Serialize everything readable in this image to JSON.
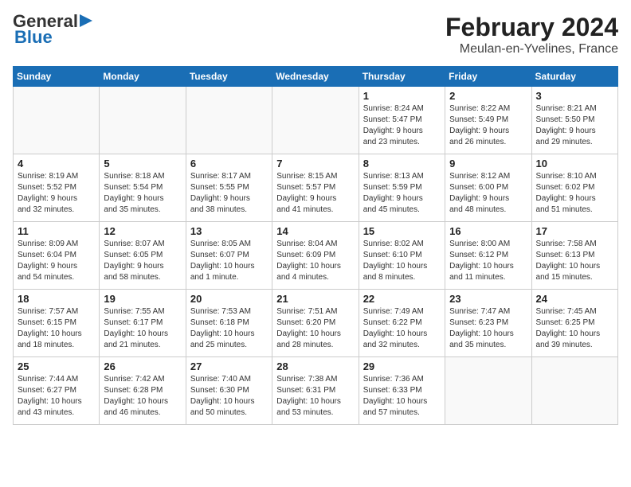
{
  "header": {
    "logo_line1": "General",
    "logo_line2": "Blue",
    "title": "February 2024",
    "subtitle": "Meulan-en-Yvelines, France"
  },
  "days_of_week": [
    "Sunday",
    "Monday",
    "Tuesday",
    "Wednesday",
    "Thursday",
    "Friday",
    "Saturday"
  ],
  "weeks": [
    [
      {
        "day": "",
        "info": ""
      },
      {
        "day": "",
        "info": ""
      },
      {
        "day": "",
        "info": ""
      },
      {
        "day": "",
        "info": ""
      },
      {
        "day": "1",
        "info": "Sunrise: 8:24 AM\nSunset: 5:47 PM\nDaylight: 9 hours\nand 23 minutes."
      },
      {
        "day": "2",
        "info": "Sunrise: 8:22 AM\nSunset: 5:49 PM\nDaylight: 9 hours\nand 26 minutes."
      },
      {
        "day": "3",
        "info": "Sunrise: 8:21 AM\nSunset: 5:50 PM\nDaylight: 9 hours\nand 29 minutes."
      }
    ],
    [
      {
        "day": "4",
        "info": "Sunrise: 8:19 AM\nSunset: 5:52 PM\nDaylight: 9 hours\nand 32 minutes."
      },
      {
        "day": "5",
        "info": "Sunrise: 8:18 AM\nSunset: 5:54 PM\nDaylight: 9 hours\nand 35 minutes."
      },
      {
        "day": "6",
        "info": "Sunrise: 8:17 AM\nSunset: 5:55 PM\nDaylight: 9 hours\nand 38 minutes."
      },
      {
        "day": "7",
        "info": "Sunrise: 8:15 AM\nSunset: 5:57 PM\nDaylight: 9 hours\nand 41 minutes."
      },
      {
        "day": "8",
        "info": "Sunrise: 8:13 AM\nSunset: 5:59 PM\nDaylight: 9 hours\nand 45 minutes."
      },
      {
        "day": "9",
        "info": "Sunrise: 8:12 AM\nSunset: 6:00 PM\nDaylight: 9 hours\nand 48 minutes."
      },
      {
        "day": "10",
        "info": "Sunrise: 8:10 AM\nSunset: 6:02 PM\nDaylight: 9 hours\nand 51 minutes."
      }
    ],
    [
      {
        "day": "11",
        "info": "Sunrise: 8:09 AM\nSunset: 6:04 PM\nDaylight: 9 hours\nand 54 minutes."
      },
      {
        "day": "12",
        "info": "Sunrise: 8:07 AM\nSunset: 6:05 PM\nDaylight: 9 hours\nand 58 minutes."
      },
      {
        "day": "13",
        "info": "Sunrise: 8:05 AM\nSunset: 6:07 PM\nDaylight: 10 hours\nand 1 minute."
      },
      {
        "day": "14",
        "info": "Sunrise: 8:04 AM\nSunset: 6:09 PM\nDaylight: 10 hours\nand 4 minutes."
      },
      {
        "day": "15",
        "info": "Sunrise: 8:02 AM\nSunset: 6:10 PM\nDaylight: 10 hours\nand 8 minutes."
      },
      {
        "day": "16",
        "info": "Sunrise: 8:00 AM\nSunset: 6:12 PM\nDaylight: 10 hours\nand 11 minutes."
      },
      {
        "day": "17",
        "info": "Sunrise: 7:58 AM\nSunset: 6:13 PM\nDaylight: 10 hours\nand 15 minutes."
      }
    ],
    [
      {
        "day": "18",
        "info": "Sunrise: 7:57 AM\nSunset: 6:15 PM\nDaylight: 10 hours\nand 18 minutes."
      },
      {
        "day": "19",
        "info": "Sunrise: 7:55 AM\nSunset: 6:17 PM\nDaylight: 10 hours\nand 21 minutes."
      },
      {
        "day": "20",
        "info": "Sunrise: 7:53 AM\nSunset: 6:18 PM\nDaylight: 10 hours\nand 25 minutes."
      },
      {
        "day": "21",
        "info": "Sunrise: 7:51 AM\nSunset: 6:20 PM\nDaylight: 10 hours\nand 28 minutes."
      },
      {
        "day": "22",
        "info": "Sunrise: 7:49 AM\nSunset: 6:22 PM\nDaylight: 10 hours\nand 32 minutes."
      },
      {
        "day": "23",
        "info": "Sunrise: 7:47 AM\nSunset: 6:23 PM\nDaylight: 10 hours\nand 35 minutes."
      },
      {
        "day": "24",
        "info": "Sunrise: 7:45 AM\nSunset: 6:25 PM\nDaylight: 10 hours\nand 39 minutes."
      }
    ],
    [
      {
        "day": "25",
        "info": "Sunrise: 7:44 AM\nSunset: 6:27 PM\nDaylight: 10 hours\nand 43 minutes."
      },
      {
        "day": "26",
        "info": "Sunrise: 7:42 AM\nSunset: 6:28 PM\nDaylight: 10 hours\nand 46 minutes."
      },
      {
        "day": "27",
        "info": "Sunrise: 7:40 AM\nSunset: 6:30 PM\nDaylight: 10 hours\nand 50 minutes."
      },
      {
        "day": "28",
        "info": "Sunrise: 7:38 AM\nSunset: 6:31 PM\nDaylight: 10 hours\nand 53 minutes."
      },
      {
        "day": "29",
        "info": "Sunrise: 7:36 AM\nSunset: 6:33 PM\nDaylight: 10 hours\nand 57 minutes."
      },
      {
        "day": "",
        "info": ""
      },
      {
        "day": "",
        "info": ""
      }
    ]
  ]
}
